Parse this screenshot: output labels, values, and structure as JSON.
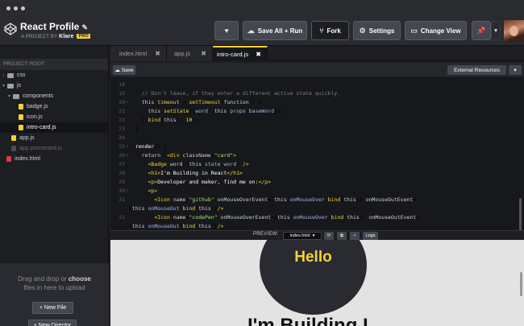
{
  "header": {
    "title": "React Profile",
    "byline_prefix": "A PROJECT BY",
    "author": "Klare",
    "badge": "PRO",
    "save_label": "Save All + Run",
    "fork_label": "Fork",
    "settings_label": "Settings",
    "change_view_label": "Change View"
  },
  "sidebar": {
    "root_label": "PROJECT ROOT",
    "items": [
      {
        "label": "css"
      },
      {
        "label": "js"
      },
      {
        "label": "components"
      },
      {
        "label": "badge.js"
      },
      {
        "label": "icon.js"
      },
      {
        "label": "intro-card.js"
      },
      {
        "label": "app.js"
      },
      {
        "label": "app.processed.js"
      },
      {
        "label": "index.html"
      }
    ],
    "drop_text_1": "Drag and drop or",
    "drop_text_2": "choose",
    "drop_text_3": "files in here to upload",
    "new_file_label": "+ New File",
    "new_directory_label": "+ New Director"
  },
  "tabs": [
    {
      "label": "index.html"
    },
    {
      "label": "app.js"
    },
    {
      "label": "intro-card.js"
    }
  ],
  "editor_toolbar": {
    "save_label": "Save",
    "external_resources_label": "External Resources"
  },
  "preview_bar": {
    "label": "PREVIEW:",
    "file_select": "index.html",
    "logs_label": "Logs"
  },
  "preview": {
    "hello": "Hello",
    "building": "I'm Building I"
  },
  "colors": {
    "accent": "#f5d238",
    "background": "#1d1e22",
    "editor_bg": "#17181b",
    "preview_bg": "#e3e3e3"
  }
}
